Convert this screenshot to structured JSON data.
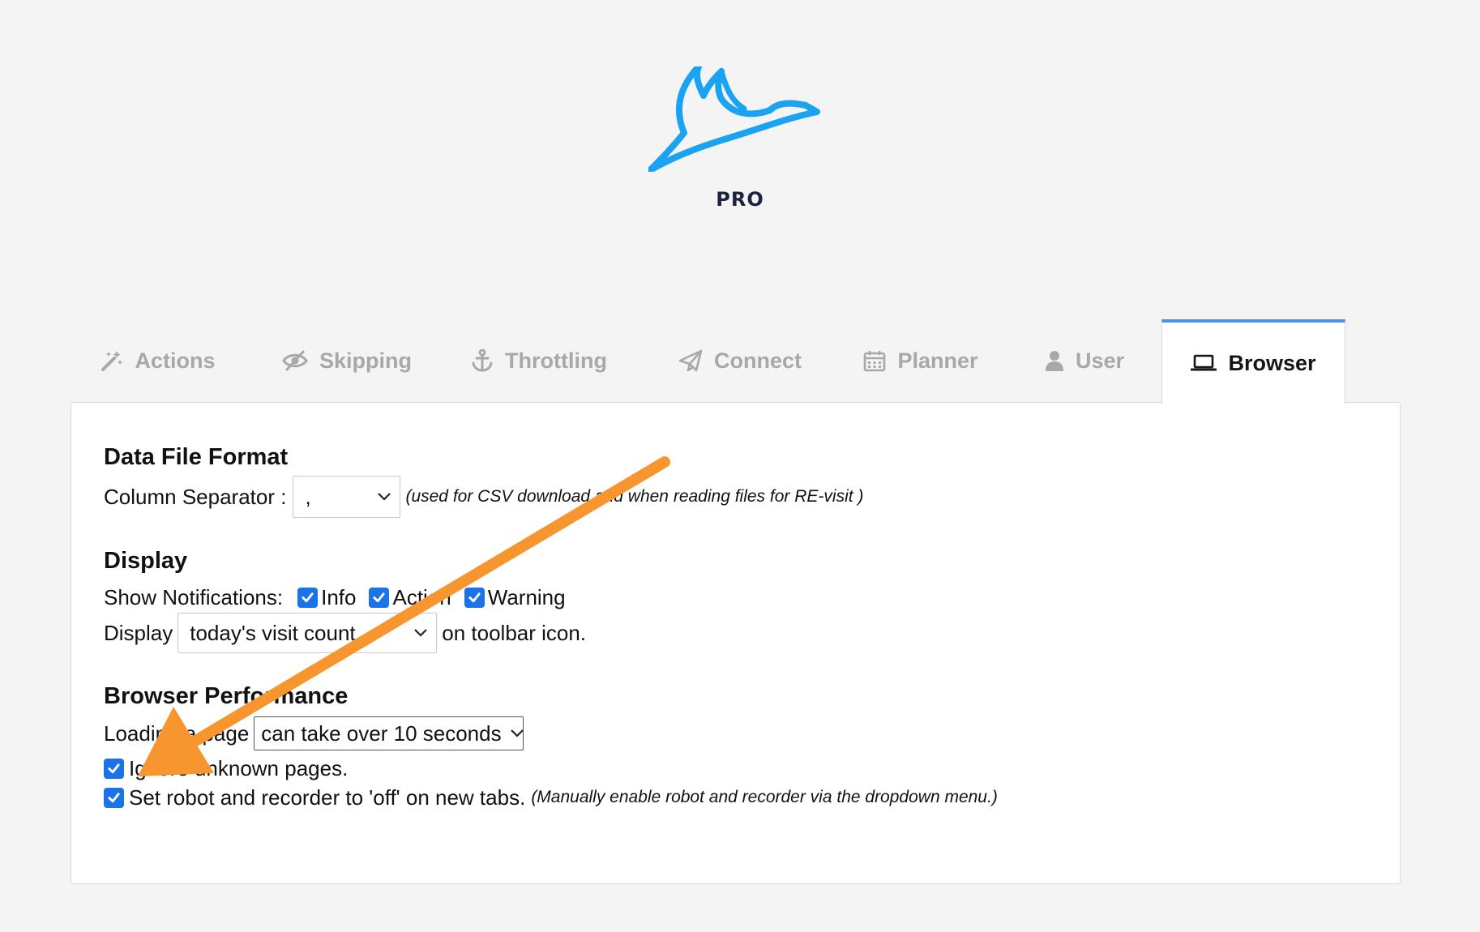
{
  "brand": {
    "label": "PRO"
  },
  "tabs": [
    {
      "label": "Actions",
      "icon": "magic-wand-icon"
    },
    {
      "label": "Skipping",
      "icon": "eye-slash-icon"
    },
    {
      "label": "Throttling",
      "icon": "anchor-icon"
    },
    {
      "label": "Connect",
      "icon": "paper-plane-icon"
    },
    {
      "label": "Planner",
      "icon": "calendar-icon"
    },
    {
      "label": "User",
      "icon": "user-icon"
    },
    {
      "label": "Browser",
      "icon": "laptop-icon",
      "active": true
    }
  ],
  "data_file_format": {
    "heading": "Data File Format",
    "column_separator_label": "Column Separator :",
    "column_separator_value": ",",
    "note": "(used for CSV download and when reading files for RE-visit )"
  },
  "display": {
    "heading": "Display",
    "notifications_label": "Show Notifications:",
    "notification_info": "Info",
    "notification_action": "Action",
    "notification_warning": "Warning",
    "display_label": "Display",
    "display_value": "today's visit count",
    "display_suffix": "on toolbar icon."
  },
  "browser_performance": {
    "heading": "Browser Performance",
    "loading_label": "Loading a page",
    "loading_value": "can take over 10 seconds",
    "ignore_unknown_label": "Ignore unknown pages.",
    "robot_off_label": "Set robot and recorder to 'off' on new tabs.",
    "robot_off_note": "(Manually enable robot and recorder via the dropdown menu.)"
  },
  "colors": {
    "accent": "#1a73e8",
    "logo": "#1aa3f0",
    "annotation_arrow": "#f7952f",
    "active_tab_border": "#4f90e6"
  }
}
